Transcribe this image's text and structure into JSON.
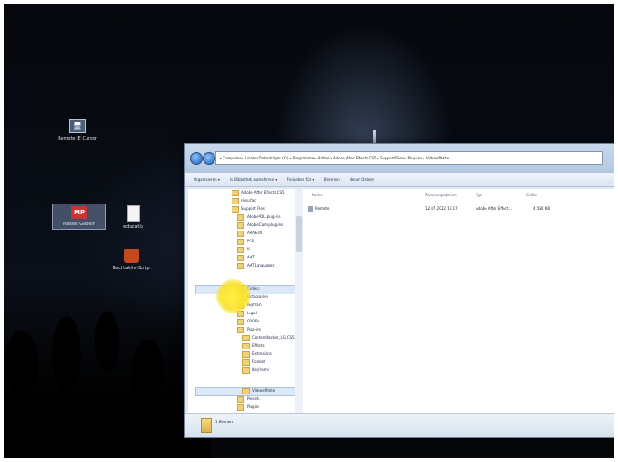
{
  "desktop": {
    "icons": [
      {
        "label": "Remote IE Cursor",
        "glyph": "🖥"
      },
      {
        "label": "Nussel Gabeln",
        "glyph": "MP"
      },
      {
        "label": "educatio",
        "glyph": "📄"
      },
      {
        "label": "Nachtaktiv-Script",
        "glyph": "🧩"
      }
    ]
  },
  "explorer": {
    "address_path": "▸ Computer ▸ Lokaler Datenträger (C:) ▸ Programme ▸ Adobe ▸ Adobe After Effects CS5 ▸ Support Files ▸ Plug-ins ▸ Videoeffekte",
    "toolbar": {
      "organize": "Organisieren ▾",
      "include": "In Bibliothek aufnehmen ▾",
      "share": "Freigeben für ▾",
      "burn": "Brennen",
      "new_folder": "Neuer Ordner"
    },
    "tree": [
      {
        "label": "Adobe After Effects CS5",
        "indent": 0
      },
      {
        "label": "resurfac",
        "indent": 0
      },
      {
        "label": "Support Files",
        "indent": 0
      },
      {
        "label": "AdobePDL.plug-ins",
        "indent": 1
      },
      {
        "label": "Adobe Cam.plug-ins",
        "indent": 1
      },
      {
        "label": "AMAEDX",
        "indent": 1
      },
      {
        "label": "PCS",
        "indent": 1
      },
      {
        "label": "IC",
        "indent": 1
      },
      {
        "label": "AMT",
        "indent": 1
      },
      {
        "label": "AMTLanguages",
        "indent": 1
      },
      {
        "label": "Codecs",
        "indent": 1
      },
      {
        "label": "Dictionaries",
        "indent": 1
      },
      {
        "label": "Keyfram",
        "indent": 1
      },
      {
        "label": "Legal",
        "indent": 1
      },
      {
        "label": "OBOBs",
        "indent": 1
      },
      {
        "label": "Plug-ins",
        "indent": 1
      },
      {
        "label": "ContentPackes_LG_CS5",
        "indent": 2
      },
      {
        "label": "Effects",
        "indent": 2
      },
      {
        "label": "Extensions",
        "indent": 2
      },
      {
        "label": "Format",
        "indent": 2
      },
      {
        "label": "Keyframe",
        "indent": 2
      },
      {
        "label": "Videoeffekte",
        "indent": 2
      },
      {
        "label": "Presets",
        "indent": 1
      },
      {
        "label": "Plugins",
        "indent": 1
      }
    ],
    "columns": {
      "name": "Name",
      "date": "Änderungsdatum",
      "type": "Typ",
      "size": "Größe"
    },
    "files": [
      {
        "name": "Remote",
        "date": "12.07.2012 16:17",
        "type": "Adobe After Effect...",
        "size": "4.580 KB"
      }
    ],
    "status": "1 Element"
  }
}
